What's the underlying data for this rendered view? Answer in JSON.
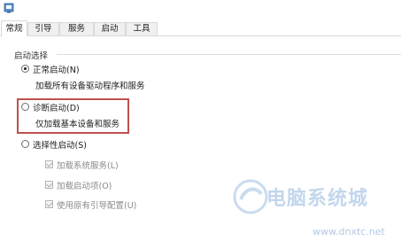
{
  "window": {
    "icon": "msconfig-icon"
  },
  "tabs": [
    {
      "label": "常规",
      "active": true
    },
    {
      "label": "引导",
      "active": false
    },
    {
      "label": "服务",
      "active": false
    },
    {
      "label": "启动",
      "active": false
    },
    {
      "label": "工具",
      "active": false
    }
  ],
  "startup": {
    "legend": "启动选择",
    "normal": {
      "label": "正常启动(N)",
      "desc": "加载所有设备驱动程序和服务",
      "selected": true
    },
    "diagnostic": {
      "label": "诊断启动(D)",
      "desc": "仅加载基本设备和服务",
      "selected": false
    },
    "selective": {
      "label": "选择性启动(S)",
      "selected": false,
      "options": [
        {
          "label": "加载系统服务(L)",
          "checked": true,
          "disabled": true
        },
        {
          "label": "加载启动项(O)",
          "checked": true,
          "disabled": true
        },
        {
          "label": "使用原有引导配置(U)",
          "checked": true,
          "disabled": true
        }
      ]
    }
  },
  "watermark": {
    "text": "电脑系统城",
    "url": "www.dnxtc.net"
  },
  "colors": {
    "highlight_border": "#c0504d",
    "watermark": "#7aa6d6"
  }
}
